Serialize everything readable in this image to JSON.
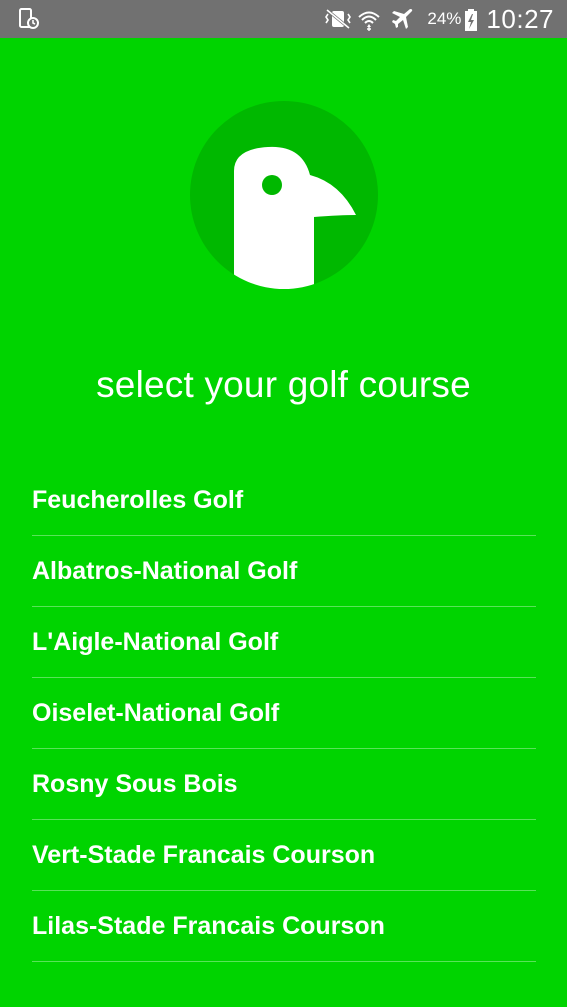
{
  "status_bar": {
    "battery_percent": "24%",
    "time": "10:27",
    "icons": [
      "screenshot-icon",
      "vibrate-icon",
      "wifi-icon",
      "airplane-icon",
      "battery-charging-icon"
    ]
  },
  "logo": {
    "icon": "bird-logo-icon",
    "circle_color": "#00b800"
  },
  "main": {
    "title": "select your golf course",
    "background_color": "#00d400",
    "courses": [
      "Feucherolles Golf",
      "Albatros-National Golf",
      "L'Aigle-National Golf",
      "Oiselet-National Golf",
      "Rosny Sous Bois",
      "Vert-Stade Francais Courson",
      "Lilas-Stade Francais Courson"
    ]
  }
}
